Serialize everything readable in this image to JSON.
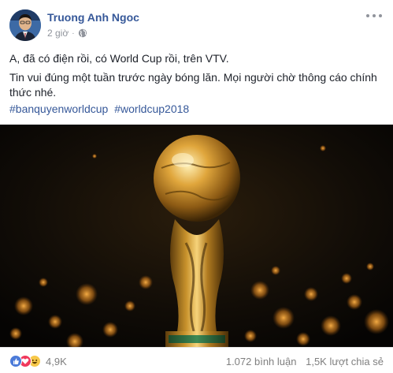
{
  "post": {
    "author": "Truong Anh Ngoc",
    "time": "2 giờ",
    "separator": "·",
    "privacy_icon": "globe-icon",
    "paragraphs": [
      "A, đã có điện rồi, có World Cup rồi, trên VTV.",
      "Tin vui đúng một tuần trước ngày bóng lăn. Mọi người chờ thông cáo chính thức nhé."
    ],
    "hashtags": [
      "#banquyenworldcup",
      "#worldcup2018"
    ],
    "image_alt_icon": "world-cup-trophy-photo"
  },
  "footer": {
    "reaction_icons": [
      "like-icon",
      "love-icon",
      "haha-icon"
    ],
    "reaction_count": "4,9K",
    "comments": "1.072 bình luận",
    "shares": "1,5K lượt chia sẻ"
  },
  "colors": {
    "link": "#365899",
    "meta": "#90949c",
    "like": "#4c7bd9",
    "love": "#f0385c",
    "haha": "#f7c84a"
  }
}
